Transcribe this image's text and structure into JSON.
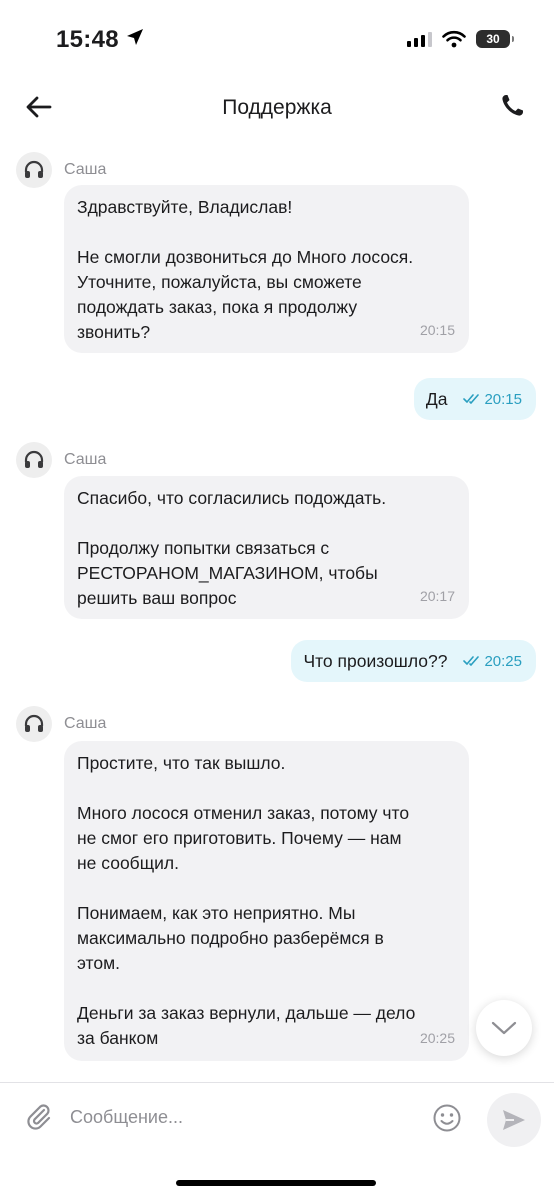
{
  "status_bar": {
    "time": "15:48",
    "battery": "30",
    "icons": [
      "location-arrow-icon",
      "signal-icon",
      "wifi-icon",
      "battery-icon"
    ]
  },
  "header": {
    "title": "Поддержка",
    "back_icon": "arrow-left-icon",
    "call_icon": "phone-icon"
  },
  "messages": [
    {
      "from": "agent",
      "agent_name": "Саша",
      "paragraphs": [
        "Здравствуйте, Владислав!",
        "Не смогли дозвониться до Много лосося.\nУточните, пожалуйста, вы сможете\nподождать заказ, пока я продолжу\nзвонить?"
      ],
      "time": "20:15"
    },
    {
      "from": "user",
      "text": "Да",
      "time": "20:15",
      "status": "read"
    },
    {
      "from": "agent",
      "agent_name": "Саша",
      "paragraphs": [
        "Спасибо, что согласились подождать.",
        "Продолжу попытки связаться с\nРЕСТОРАНОМ_МАГАЗИНОМ, чтобы\nрешить ваш вопрос"
      ],
      "time": "20:17"
    },
    {
      "from": "user",
      "text": "Что произошло??",
      "time": "20:25",
      "status": "read"
    },
    {
      "from": "agent",
      "agent_name": "Саша",
      "paragraphs": [
        "Простите, что так вышло.",
        "Много лосося отменил заказ, потому что\nне смог его приготовить. Почему — нам\nне сообщил.",
        "Понимаем, как это неприятно. Мы\nмаксимально подробно разберёмся в\nэтом.",
        "Деньги за заказ вернули, дальше — дело\nза банком"
      ],
      "time": "20:25"
    }
  ],
  "composer": {
    "placeholder": "Сообщение...",
    "value": "",
    "attach_icon": "paperclip-icon",
    "emoji_icon": "emoji-smile-icon",
    "send_icon": "send-icon"
  },
  "scroll_button_icon": "chevron-down-icon",
  "colors": {
    "incoming_bubble": "#f2f2f4",
    "outgoing_bubble": "#e4f6fb",
    "read_check": "#2a9fc0",
    "muted_text": "#8e8e93"
  }
}
